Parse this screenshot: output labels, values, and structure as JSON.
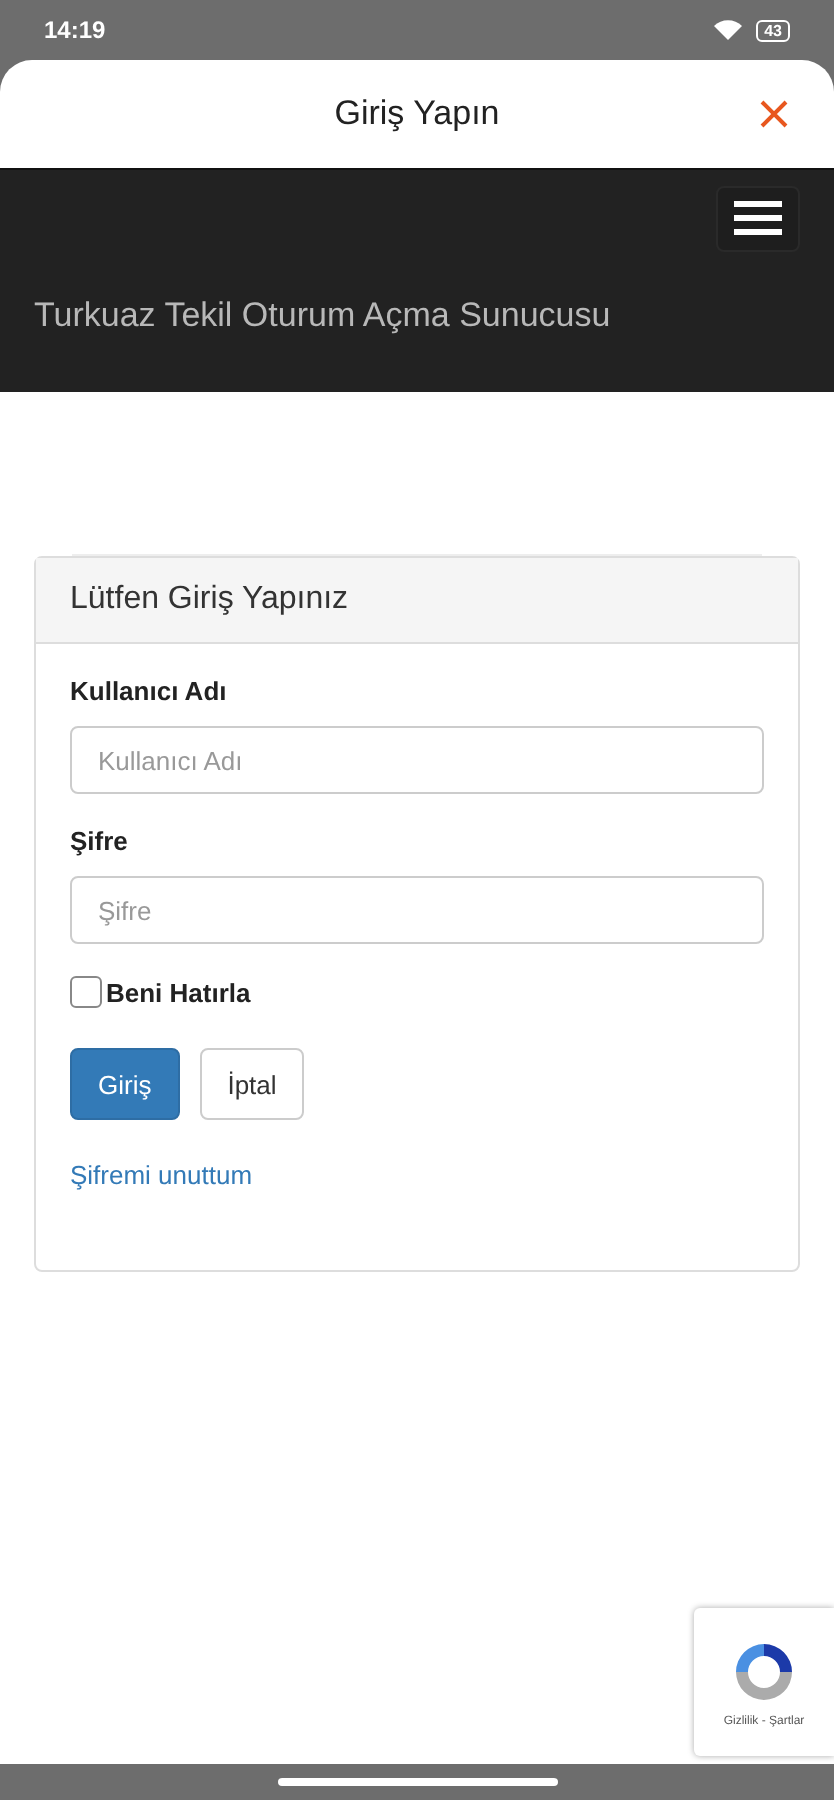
{
  "status_bar": {
    "time": "14:19",
    "battery": "43"
  },
  "sheet": {
    "title": "Giriş Yapın"
  },
  "navbar": {
    "brand": "Turkuaz Tekil Oturum Açma Sunucusu"
  },
  "panel": {
    "heading": "Lütfen Giriş Yapınız",
    "fields": [
      {
        "label": "Kullanıcı Adı",
        "placeholder": "Kullanıcı Adı"
      },
      {
        "label": "Şifre",
        "placeholder": "Şifre"
      }
    ],
    "remember": {
      "label": "Beni Hatırla",
      "checked": false
    },
    "buttons": [
      {
        "label": "Giriş",
        "kind": "primary"
      },
      {
        "label": "İptal",
        "kind": "default"
      }
    ],
    "forgot_link": "Şifremi unuttum"
  },
  "recaptcha": {
    "links": "Gizlilik - Şartlar"
  }
}
